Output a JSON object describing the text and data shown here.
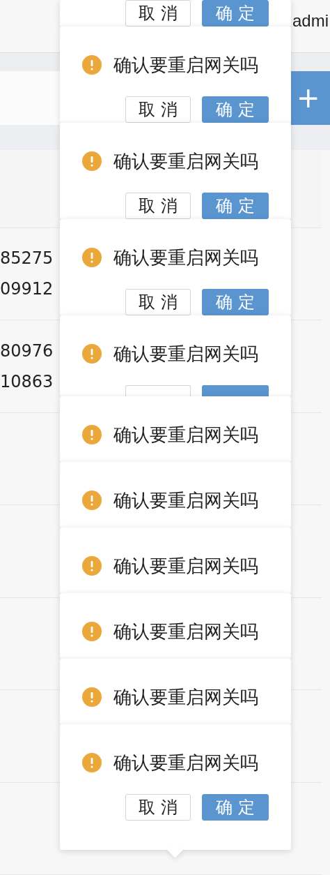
{
  "header": {
    "user_text": "admi"
  },
  "toolbar": {
    "add_button": "+"
  },
  "table": {
    "rows": [
      {
        "lines": [
          "85275",
          "09912"
        ]
      },
      {
        "lines": [
          "80976",
          "10863"
        ]
      }
    ]
  },
  "popconfirms": [
    {
      "kind": "buttons_only",
      "cancel": "取 消",
      "ok": "确 定"
    },
    {
      "kind": "stacked",
      "message": "确认要重启网关吗",
      "cancel": "取 消",
      "ok": "确 定"
    },
    {
      "kind": "stacked",
      "message": "确认要重启网关吗",
      "cancel": "取 消",
      "ok": "确 定"
    },
    {
      "kind": "stacked",
      "message": "确认要重启网关吗",
      "cancel": "取 消",
      "ok": "确 定"
    },
    {
      "kind": "partial",
      "message": "确认要重启网关吗"
    },
    {
      "kind": "message_only",
      "message": "确认要重启网关吗"
    },
    {
      "kind": "message_only",
      "message": "确认要重启网关吗"
    },
    {
      "kind": "message_only",
      "message": "确认要重启网关吗"
    },
    {
      "kind": "message_only",
      "message": "确认要重启网关吗"
    },
    {
      "kind": "message_only",
      "message": "确认要重启网关吗"
    },
    {
      "kind": "full",
      "message": "确认要重启网关吗",
      "cancel": "取 消",
      "ok": "确 定"
    }
  ]
}
